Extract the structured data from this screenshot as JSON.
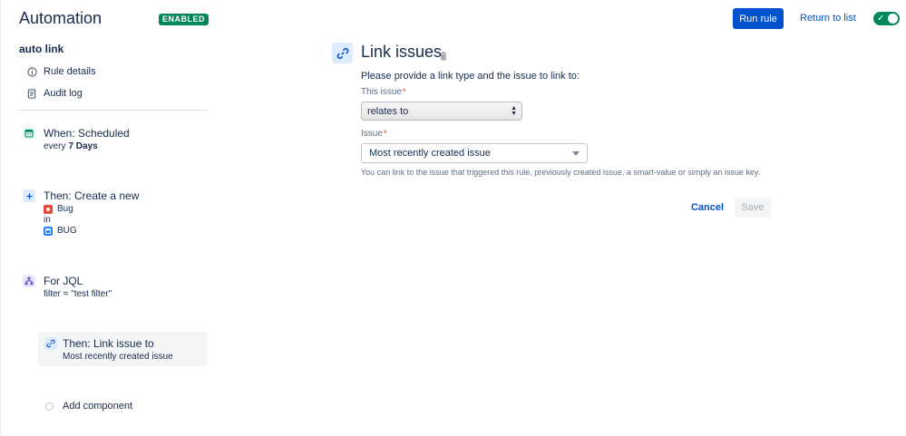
{
  "header": {
    "title": "Automation",
    "badge": "ENABLED",
    "run_rule": "Run rule",
    "return_to_list": "Return to list",
    "toggle_check": "✓"
  },
  "sidebar": {
    "rule_name": "auto link",
    "nav": [
      {
        "label": "Rule details",
        "icon": "info-icon"
      },
      {
        "label": "Audit log",
        "icon": "document-icon"
      }
    ],
    "components": [
      {
        "title": "When: Scheduled",
        "sub_prefix": "every",
        "sub_bold": "7 Days",
        "icon": "calendar-icon",
        "color": "#00875a"
      },
      {
        "title": "Then: Create a new",
        "issue_type": "Bug",
        "in": "in",
        "project": "BUG",
        "icon": "plus-icon",
        "color": "#0052cc"
      },
      {
        "title": "For JQL",
        "sub": "filter = \"test filter\"",
        "icon": "branch-icon",
        "color": "#6554c0"
      }
    ],
    "selected": {
      "title": "Then: Link issue to",
      "sub": "Most recently created issue",
      "icon": "link-icon"
    },
    "add_component": "Add component"
  },
  "panel": {
    "title": "Link issues",
    "instructions": "Please provide a link type and the issue to link to:",
    "this_issue_label": "This issue",
    "link_type_value": "relates to",
    "issue_label": "Issue",
    "issue_value": "Most recently created issue",
    "help": "You can link to the issue that triggered this rule, previously created issue, a smart-value or simply an issue key.",
    "required_marker": "*",
    "cancel": "Cancel",
    "save": "Save"
  },
  "colors": {
    "primary": "#0052cc",
    "success": "#00875a",
    "bug": "#e5493a"
  }
}
